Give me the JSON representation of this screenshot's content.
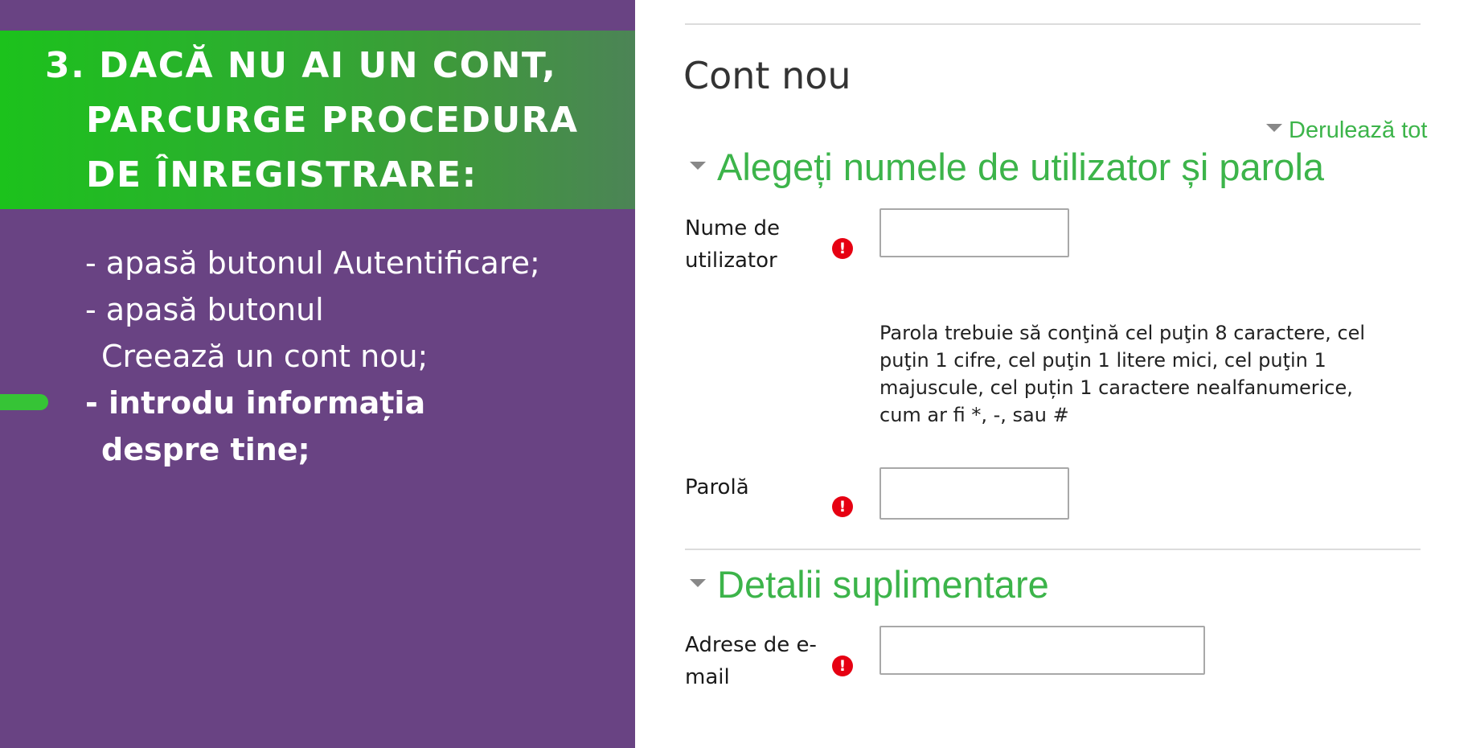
{
  "slide": {
    "heading_lines": [
      "3. DACĂ NU AI UN CONT,",
      "PARCURGE PROCEDURA",
      "DE ÎNREGISTRARE:"
    ],
    "steps": {
      "line1": "- apasă butonul Autentificare;",
      "line2": "- apasă butonul",
      "line3": "Creează un cont nou;",
      "line4": "- introdu informația",
      "line5": "despre tine;"
    },
    "colors": {
      "panel_bg": "#694383",
      "banner_green": "#1cc21c",
      "marker_green": "#36c436"
    }
  },
  "form": {
    "title": "Cont nou",
    "collapse_all_label": "Derulează tot",
    "accent_color": "#3cb44a",
    "required_icon": "exclamation-circle-icon",
    "required_glyph": "!",
    "section1": {
      "header": "Alegeți numele de utilizator și parola",
      "username_label_line1": "Nume de",
      "username_label_line2": "utilizator",
      "username_value": "",
      "password_policy": "Parola trebuie să conţină cel puţin 8 caractere, cel puţin 1 cifre, cel puţin 1 litere mici, cel puţin 1 majuscule, cel puțin 1 caractere nealfanumerice, cum ar fi *, -, sau #",
      "password_label": "Parolă",
      "password_value": ""
    },
    "section2": {
      "header": "Detalii suplimentare",
      "email_label_line1": "Adrese de e-",
      "email_label_line2": "mail",
      "email_value": ""
    }
  }
}
